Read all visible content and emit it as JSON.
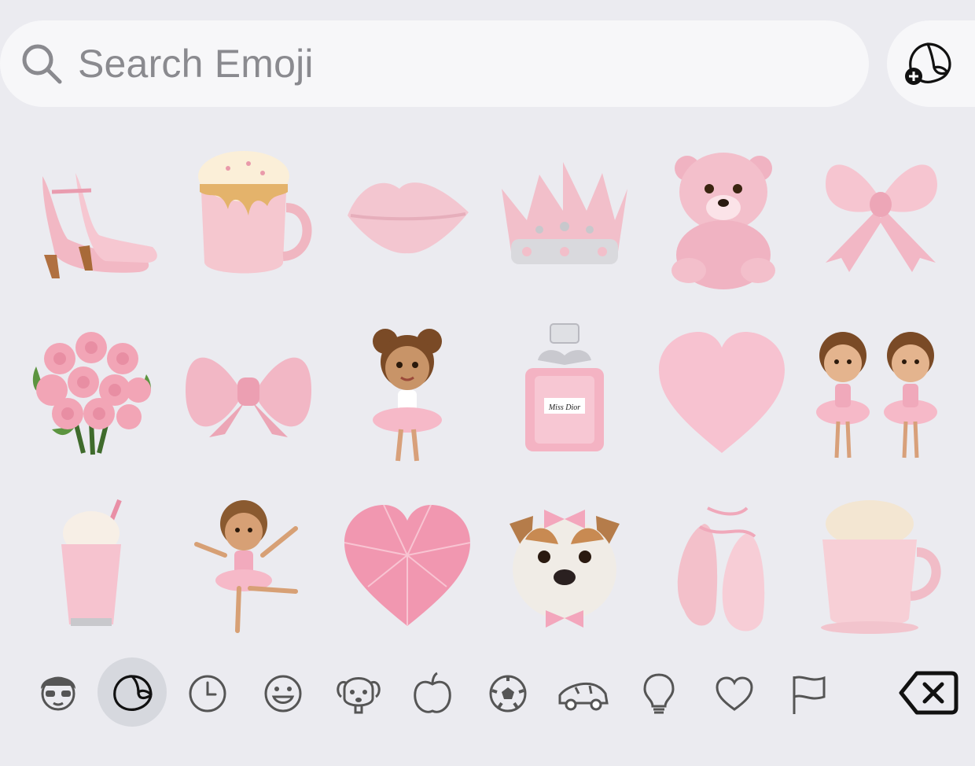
{
  "search": {
    "placeholder": "Search Emoji",
    "icon": "magnifier-icon"
  },
  "sticker_button": {
    "icon": "add-sticker-icon"
  },
  "stickers": [
    {
      "name": "pink-high-heels"
    },
    {
      "name": "pink-latte-mug"
    },
    {
      "name": "pink-kiss-lips"
    },
    {
      "name": "pink-crown"
    },
    {
      "name": "pink-teddy-bear"
    },
    {
      "name": "pink-ribbon-bow"
    },
    {
      "name": "pink-rose-bouquet"
    },
    {
      "name": "pink-satin-bow"
    },
    {
      "name": "ballerina-girl"
    },
    {
      "name": "pink-perfume-bottle"
    },
    {
      "name": "pink-heart"
    },
    {
      "name": "ballerina-twins"
    },
    {
      "name": "pink-milkshake"
    },
    {
      "name": "dancing-ballerina"
    },
    {
      "name": "pink-diamond-heart"
    },
    {
      "name": "bulldog-with-bow"
    },
    {
      "name": "pink-ballet-slippers"
    },
    {
      "name": "pink-hot-cocoa-cup"
    }
  ],
  "perfume_label": "Miss Dior",
  "categories": [
    {
      "icon": "memoji-icon",
      "active": false
    },
    {
      "icon": "stickers-icon",
      "active": true
    },
    {
      "icon": "recents-clock-icon",
      "active": false
    },
    {
      "icon": "smiley-icon",
      "active": false
    },
    {
      "icon": "animals-icon",
      "active": false
    },
    {
      "icon": "food-apple-icon",
      "active": false
    },
    {
      "icon": "activity-soccer-icon",
      "active": false
    },
    {
      "icon": "travel-car-icon",
      "active": false
    },
    {
      "icon": "objects-lightbulb-icon",
      "active": false
    },
    {
      "icon": "symbols-heart-icon",
      "active": false
    },
    {
      "icon": "flags-icon",
      "active": false
    }
  ],
  "delete_key": {
    "icon": "delete-backspace-icon"
  }
}
